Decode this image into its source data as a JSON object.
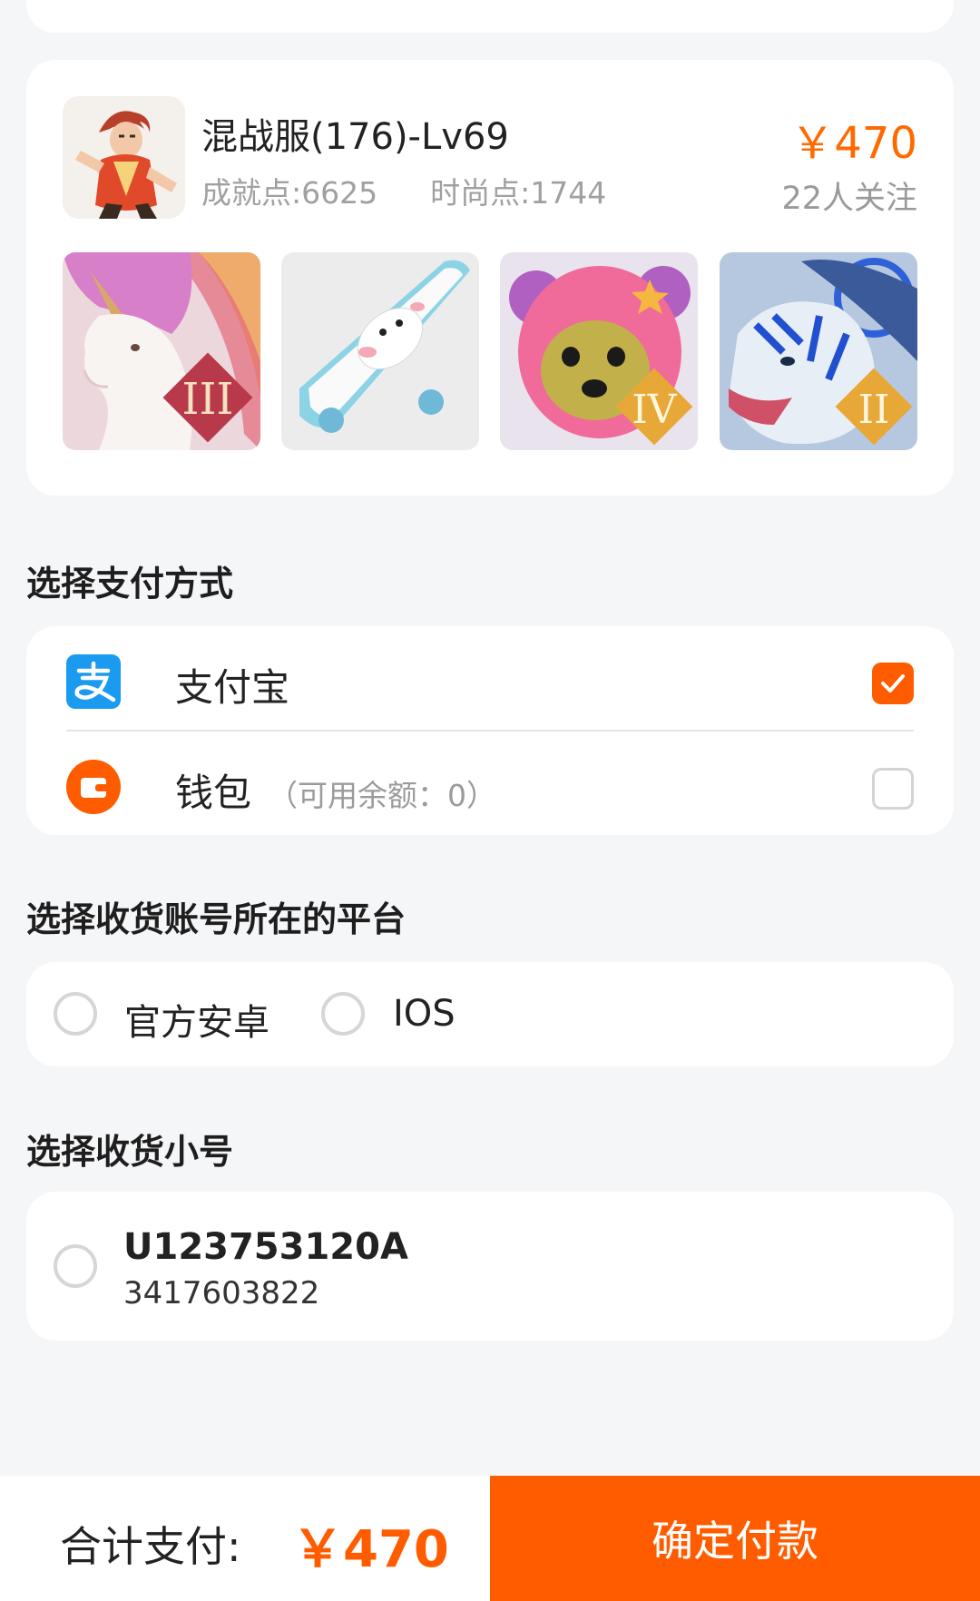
{
  "product": {
    "title": "混战服(176)-Lv69",
    "achievement": "成就点:6625",
    "fashion": "时尚点:1744",
    "price": "￥470",
    "followers": "22人关注",
    "items": [
      {
        "icon": "unicorn-mount",
        "badge": "III"
      },
      {
        "icon": "skateboard",
        "badge": ""
      },
      {
        "icon": "pink-bear-hat",
        "badge": "IV"
      },
      {
        "icon": "blue-tiger",
        "badge": "II"
      }
    ]
  },
  "payment": {
    "section_title": "选择支付方式",
    "options": [
      {
        "label": "支付宝",
        "note": "",
        "checked": true,
        "icon": "alipay-icon"
      },
      {
        "label": "钱包",
        "note": "（可用余额：0）",
        "checked": false,
        "icon": "wallet-icon"
      }
    ]
  },
  "platform": {
    "section_title": "选择收货账号所在的平台",
    "options": [
      "官方安卓",
      "IOS"
    ]
  },
  "account": {
    "section_title": "选择收货小号",
    "name": "U123753120A",
    "id": "3417603822"
  },
  "footer": {
    "total_label": "合计支付:",
    "total_amount": "￥470",
    "confirm_label": "确定付款"
  },
  "colors": {
    "accent": "#ff5c00",
    "price": "#ff6a00",
    "background": "#f5f6f8",
    "alipay": "#1a9bf0"
  }
}
